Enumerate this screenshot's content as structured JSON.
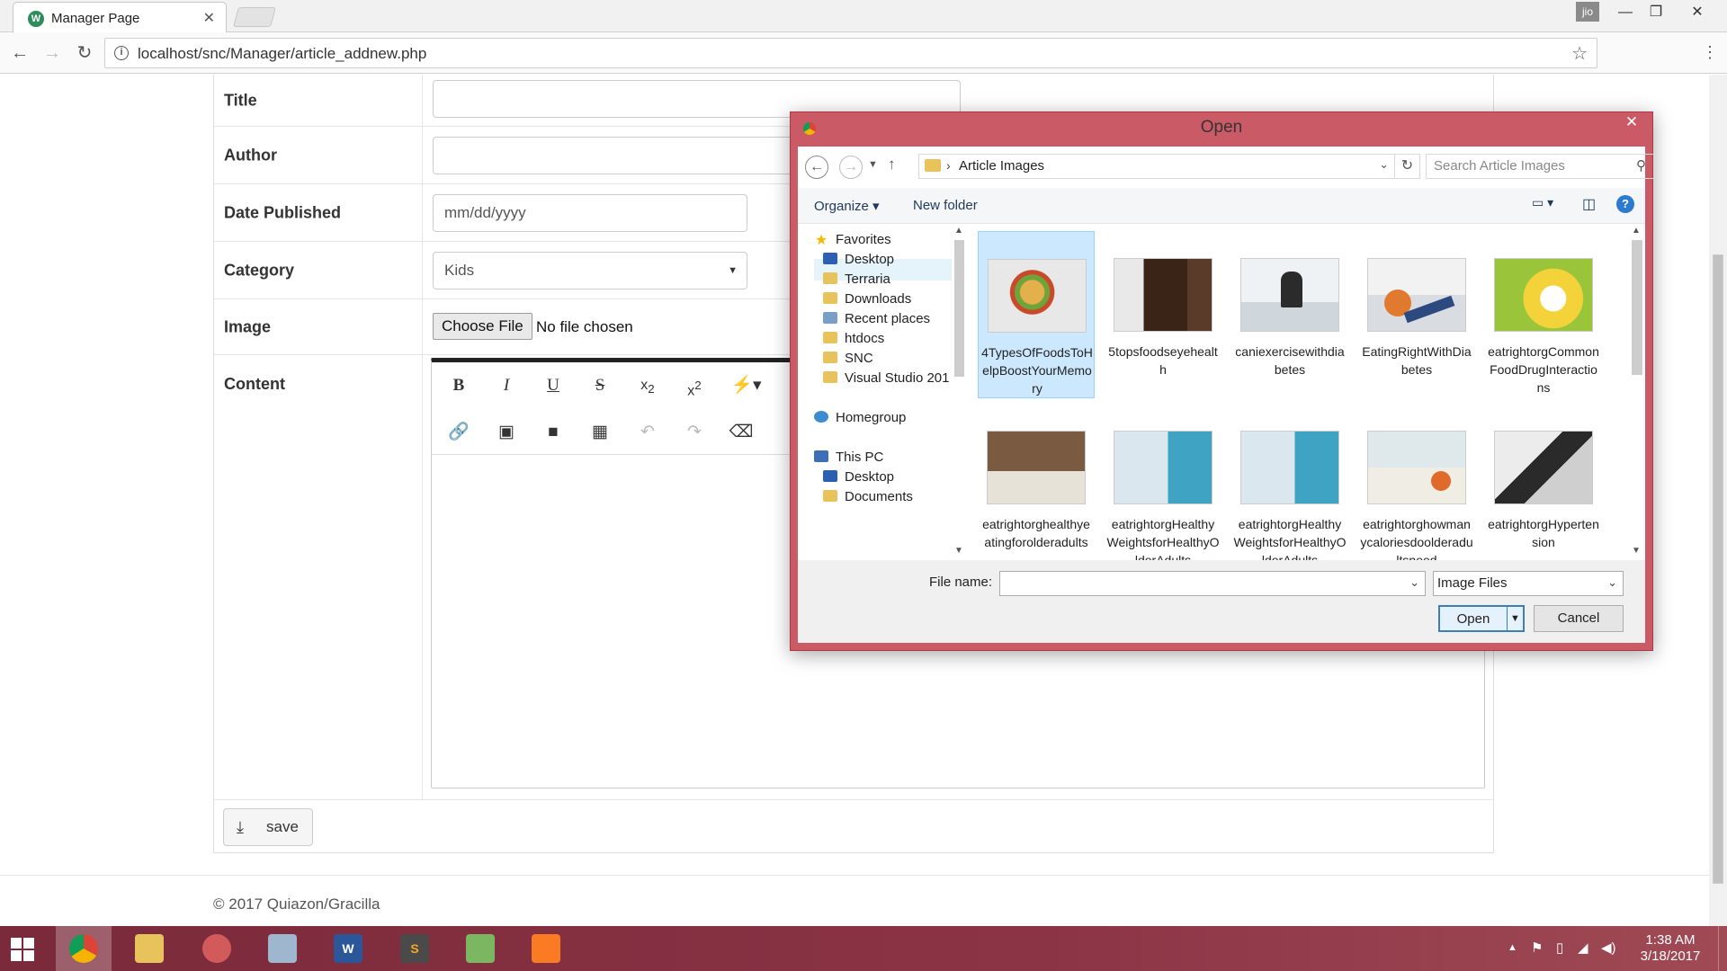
{
  "browser": {
    "tab_title": "Manager Page",
    "tab_favicon": "W",
    "profile_name": "jio",
    "url": "localhost/snc/Manager/article_addnew.php"
  },
  "form": {
    "title_label": "Title",
    "author_label": "Author",
    "date_label": "Date Published",
    "date_placeholder": "mm/dd/yyyy",
    "category_label": "Category",
    "category_value": "Kids",
    "image_label": "Image",
    "choose_file_label": "Choose File",
    "no_file_text": "No file chosen",
    "content_label": "Content",
    "save_label": "save"
  },
  "footer": {
    "copyright": "© 2017 Quiazon/Gracilla"
  },
  "dialog": {
    "title": "Open",
    "current_folder": "Article Images",
    "search_placeholder": "Search Article Images",
    "organize_label": "Organize",
    "new_folder_label": "New folder",
    "nav": {
      "favorites": "Favorites",
      "items": [
        "Desktop",
        "Terraria",
        "Downloads",
        "Recent places",
        "htdocs",
        "SNC",
        "Visual Studio 201"
      ],
      "homegroup": "Homegroup",
      "this_pc": "This PC",
      "pc_items": [
        "Desktop",
        "Documents"
      ]
    },
    "files": [
      "4TypesOfFoodsToHelpBoostYourMemory",
      "5topsfoodseyehealth",
      "caniexercisewithdiabetes",
      "EatingRightWithDiabetes",
      "eatrightorgCommonFoodDrugInteractions",
      "eatrightorghealthyeatingforolderadults",
      "eatrightorgHealthyWeightsforHealthyOlderAdults",
      "eatrightorgHealthyWeightsforHealthyOlderAdults",
      "eatrightorghowmanycaloriesdoolderadultsneed",
      "eatrightorgHypertension"
    ],
    "file_name_label": "File name:",
    "file_name_value": "",
    "file_type": "Image Files",
    "open_label": "Open",
    "cancel_label": "Cancel"
  },
  "taskbar": {
    "time": "1:38 AM",
    "date": "3/18/2017"
  }
}
